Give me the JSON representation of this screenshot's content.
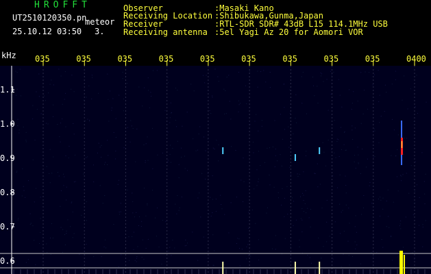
{
  "header": {
    "logo": "HROFFT",
    "file_name": "UT2510120350.pn",
    "mode": "meteor",
    "datetime": "25.10.12 03:50",
    "count": "3.",
    "fields": [
      {
        "label": "Observer",
        "value": ":Masaki Kano"
      },
      {
        "label": "Receiving Location",
        "value": ":Shibukawa,Gunma,Japan"
      },
      {
        "label": "Receiver",
        "value": ":RTL-SDR SDR# 43dB L15 114.1MHz USB"
      },
      {
        "label": "Receiving antenna",
        "value": ":5el Yagi Az 20 for Aomori VOR"
      }
    ]
  },
  "chart_data": {
    "type": "heatmap",
    "ylabel": "kHz",
    "ylim": [
      0.6,
      1.15
    ],
    "y_ticks": [
      "1.1",
      "1.0",
      "0.9",
      "0.8",
      "0.7",
      "0.6"
    ],
    "x_ticks": [
      "035",
      "035",
      "035",
      "035",
      "035",
      "035",
      "035",
      "035",
      "035",
      "0400"
    ],
    "events": [
      {
        "time_frac": 0.482,
        "freq": 0.92,
        "color": "#4fd0ff"
      },
      {
        "time_frac": 0.677,
        "freq": 0.9,
        "color": "#4fd0ff"
      },
      {
        "time_frac": 0.742,
        "freq": 0.92,
        "color": "#4fd0ff"
      },
      {
        "time_frac": 0.965,
        "freq": 0.93,
        "color": "#ff2020"
      }
    ],
    "colors": {
      "background": "#00001e",
      "grid": "#2a2a48",
      "hline": "#c8c8c8",
      "tick": "#ffff3c"
    }
  }
}
